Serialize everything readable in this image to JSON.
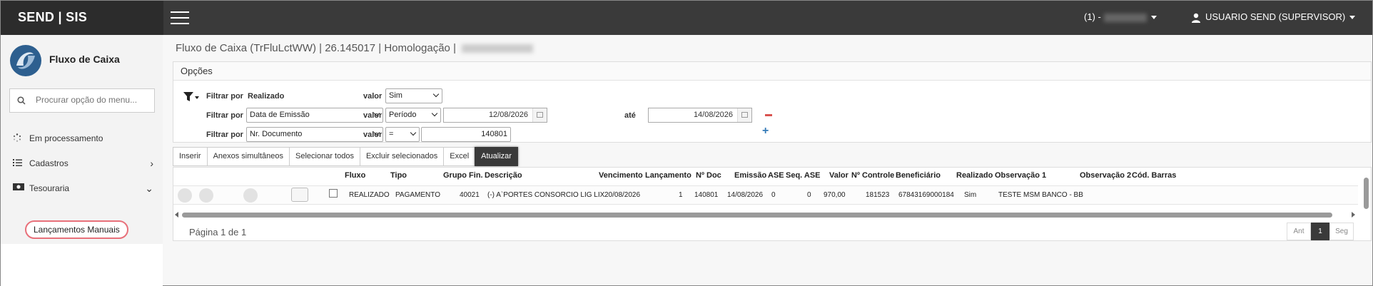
{
  "topbar": {
    "brand": "SEND | SIS",
    "company_prefix": "(1) -",
    "user": "USUARIO SEND (SUPERVISOR)"
  },
  "sidebar": {
    "module_title": "Fluxo de Caixa",
    "search_placeholder": "Procurar opção do menu...",
    "items": [
      {
        "label": "Em processamento",
        "icon": "spinner-icon"
      },
      {
        "label": "Cadastros",
        "icon": "list-icon"
      },
      {
        "label": "Tesouraria",
        "icon": "money-icon"
      }
    ],
    "sub_active": "Lançamentos Manuais"
  },
  "page": {
    "title": "Fluxo de Caixa (TrFluLctWW) | 26.145017 | Homologação |"
  },
  "options": {
    "header": "Opções",
    "filter_label": "Filtrar por",
    "valor_label": "valor",
    "ate_label": "até",
    "rows": [
      {
        "field": "Realizado",
        "op": "Sim"
      },
      {
        "field": "Data de Emissão",
        "op": "Período",
        "from": "12/08/2026",
        "to": "14/08/2026"
      },
      {
        "field": "Nr. Documento",
        "op": "=",
        "value": "140801"
      }
    ]
  },
  "toolbar": {
    "inserir": "Inserir",
    "anexos": "Anexos simultâneos",
    "sel_todos": "Selecionar todos",
    "excluir": "Excluir selecionados",
    "excel": "Excel",
    "atualizar": "Atualizar"
  },
  "grid": {
    "headers": {
      "fluxo": "Fluxo",
      "tipo": "Tipo",
      "grupo": "Grupo Fin.",
      "descricao": "Descrição",
      "vencimento": "Vencimento",
      "lancamento": "Lançamento",
      "ndoc": "Nº Doc",
      "emissao": "Emissão",
      "ase": "ASE",
      "seqase": "Seq. ASE",
      "valor": "Valor",
      "ncontrole": "Nº Controle",
      "beneficiario": "Beneficiário",
      "realizado": "Realizado",
      "obs1": "Observação 1",
      "obs2": "Observação 2",
      "codbarras": "Cód. Barras"
    },
    "row": {
      "fluxo": "REALIZADO",
      "tipo": "PAGAMENTO",
      "grupo": "40021",
      "descricao": "(-) A`PORTES CONSORCIO LIG LIX",
      "vencimento": "20/08/2026",
      "lancamento": "1",
      "ndoc": "140801",
      "emissao": "14/08/2026",
      "ase": "0",
      "seqase": "0",
      "valor": "970,00",
      "ncontrole": "181523",
      "beneficiario": "67843169000184",
      "realizado": "Sim",
      "obs1": "TESTE MSM BANCO - BB",
      "obs2": "",
      "codbarras": ""
    },
    "pagination": {
      "text": "Página 1 de 1",
      "prev": "Ant",
      "current": "1",
      "next": "Seg"
    }
  },
  "colors": {
    "topbar": "#3a3a3a",
    "accent_red": "#d9534f",
    "accent_blue": "#337ab7",
    "highlight": "#e8707a"
  }
}
